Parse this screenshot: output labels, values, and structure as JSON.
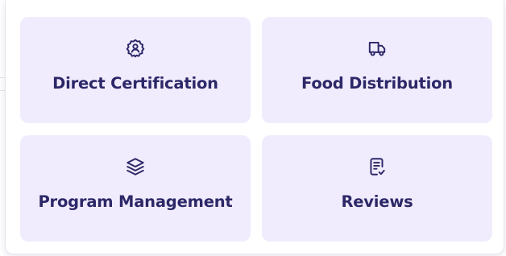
{
  "menu": {
    "tiles": [
      {
        "label": "Direct Certification",
        "icon": "certificate-badge-icon"
      },
      {
        "label": "Food Distribution",
        "icon": "truck-icon"
      },
      {
        "label": "Program Management",
        "icon": "layers-icon"
      },
      {
        "label": "Reviews",
        "icon": "clipboard-document-icon"
      }
    ]
  },
  "colors": {
    "tile_background": "#f1ecfd",
    "text_primary": "#2c2868"
  }
}
